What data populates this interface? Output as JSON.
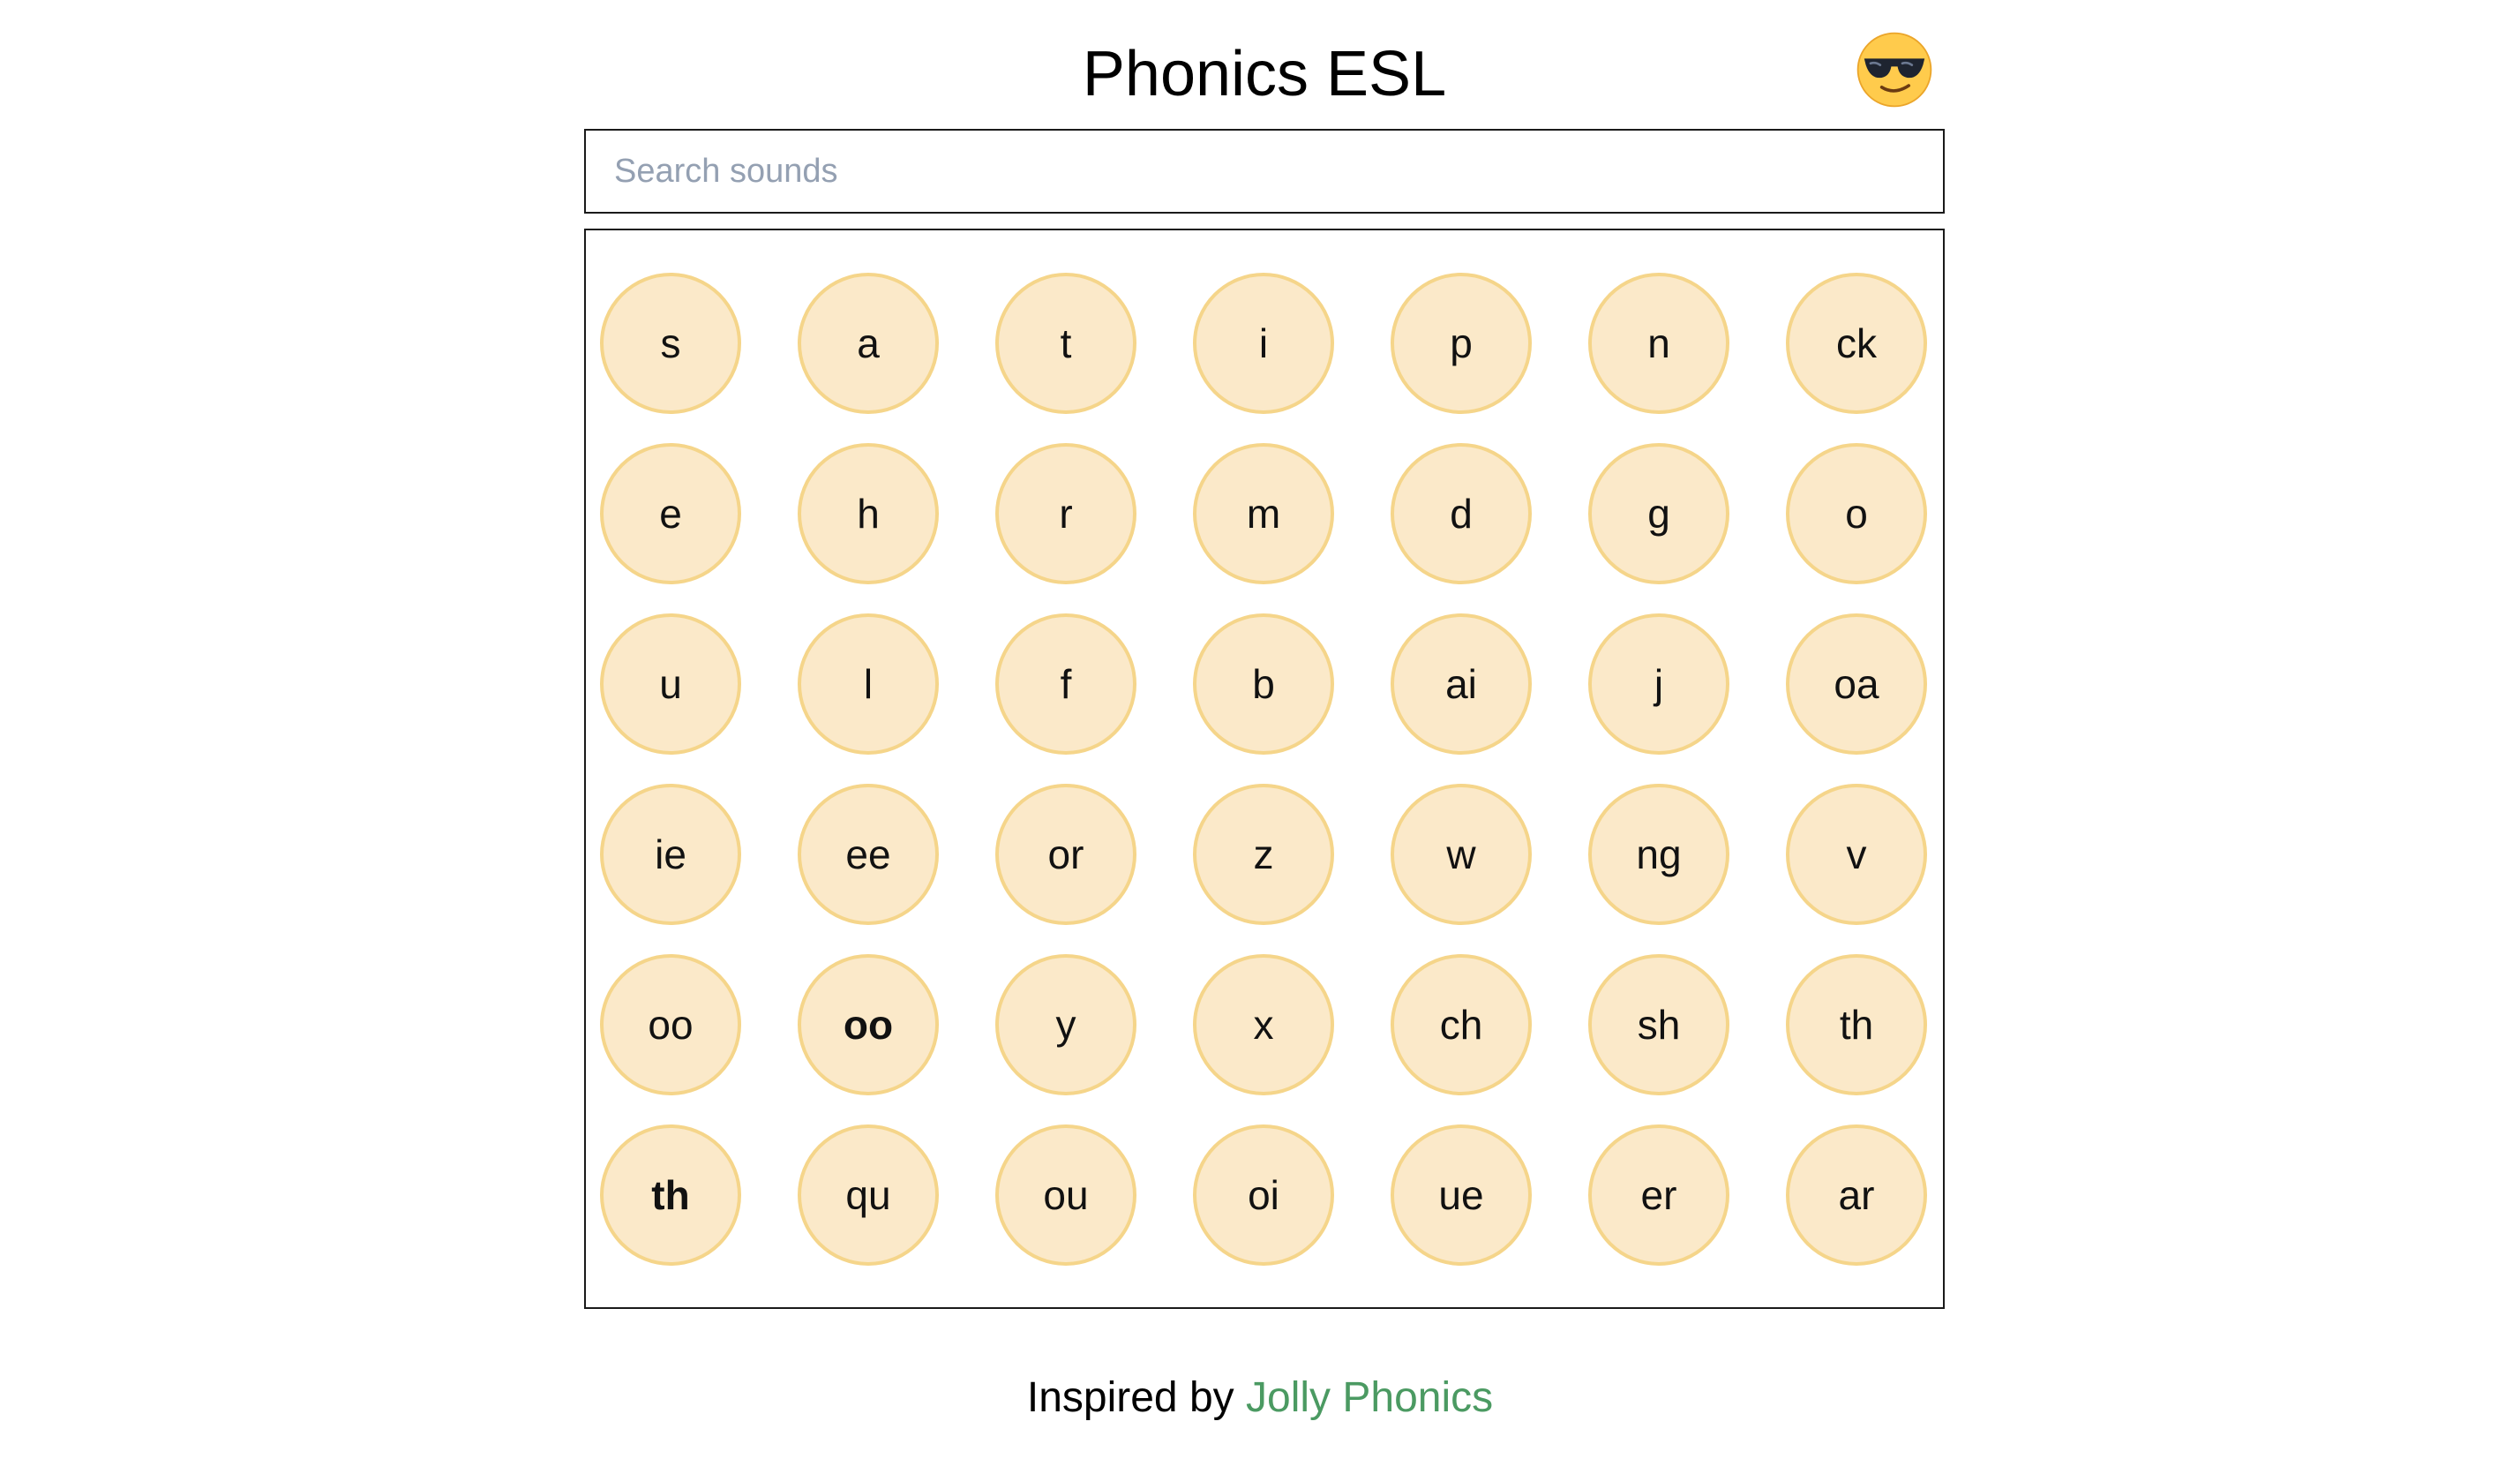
{
  "app": {
    "title": "Phonics ESL"
  },
  "mode_toggle": {
    "icon": "sunglasses-emoji",
    "glyph": "😎"
  },
  "search": {
    "placeholder": "Search sounds",
    "value": ""
  },
  "sounds": [
    {
      "label": "s",
      "bold": false
    },
    {
      "label": "a",
      "bold": false
    },
    {
      "label": "t",
      "bold": false
    },
    {
      "label": "i",
      "bold": false
    },
    {
      "label": "p",
      "bold": false
    },
    {
      "label": "n",
      "bold": false
    },
    {
      "label": "ck",
      "bold": false
    },
    {
      "label": "e",
      "bold": false
    },
    {
      "label": "h",
      "bold": false
    },
    {
      "label": "r",
      "bold": false
    },
    {
      "label": "m",
      "bold": false
    },
    {
      "label": "d",
      "bold": false
    },
    {
      "label": "g",
      "bold": false
    },
    {
      "label": "o",
      "bold": false
    },
    {
      "label": "u",
      "bold": false
    },
    {
      "label": "l",
      "bold": false
    },
    {
      "label": "f",
      "bold": false
    },
    {
      "label": "b",
      "bold": false
    },
    {
      "label": "ai",
      "bold": false
    },
    {
      "label": "j",
      "bold": false
    },
    {
      "label": "oa",
      "bold": false
    },
    {
      "label": "ie",
      "bold": false
    },
    {
      "label": "ee",
      "bold": false
    },
    {
      "label": "or",
      "bold": false
    },
    {
      "label": "z",
      "bold": false
    },
    {
      "label": "w",
      "bold": false
    },
    {
      "label": "ng",
      "bold": false
    },
    {
      "label": "v",
      "bold": false
    },
    {
      "label": "oo",
      "bold": false
    },
    {
      "label": "oo",
      "bold": true
    },
    {
      "label": "y",
      "bold": false
    },
    {
      "label": "x",
      "bold": false
    },
    {
      "label": "ch",
      "bold": false
    },
    {
      "label": "sh",
      "bold": false
    },
    {
      "label": "th",
      "bold": false
    },
    {
      "label": "th",
      "bold": true
    },
    {
      "label": "qu",
      "bold": false
    },
    {
      "label": "ou",
      "bold": false
    },
    {
      "label": "oi",
      "bold": false
    },
    {
      "label": "ue",
      "bold": false
    },
    {
      "label": "er",
      "bold": false
    },
    {
      "label": "ar",
      "bold": false
    }
  ],
  "colors": {
    "circle_fill": "#fbe9c9",
    "circle_border": "#f5d58a",
    "link": "#4b9a62",
    "placeholder": "#94a0b2"
  },
  "footer": {
    "prefix": "Inspired by ",
    "link_label": "Jolly Phonics"
  }
}
